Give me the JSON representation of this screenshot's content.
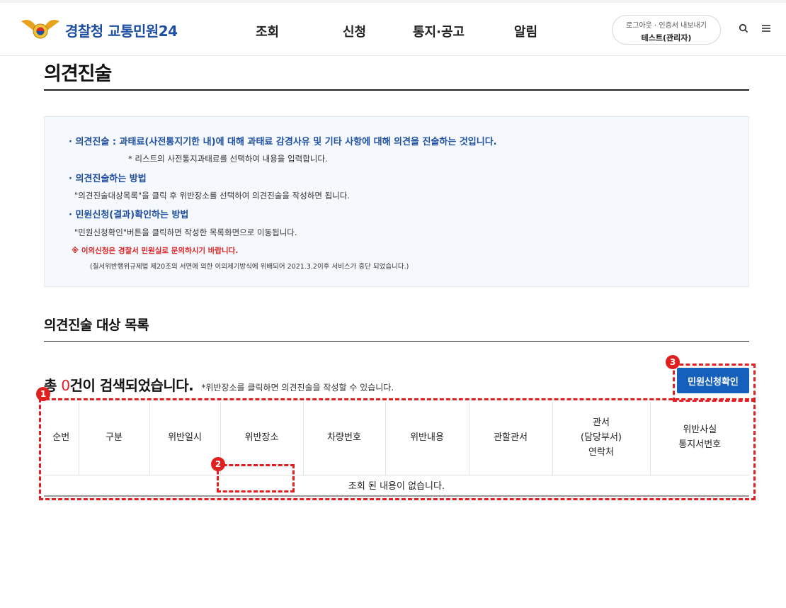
{
  "header": {
    "logo_text": "경찰청 교통민원24",
    "nav": [
      "조회",
      "신청",
      "통지·공고",
      "알림"
    ],
    "login_links": "로그아웃 · 인증서 내보내기",
    "user_name": "테스트(관리자)"
  },
  "page_title": "의견진술",
  "info": {
    "line1": "· 의견진술 : 과태료(사전통지기한 내)에 대해 과태료 감경사유 및 기타 사항에 대해 의견을 진술하는 것입니다.",
    "line2": "* 리스트의 사전통지과태료를 선택하여 내용을 입력합니다.",
    "line3": "· 의견진술하는 방법",
    "line4": "\"의견진술대상목록\"을 클릭 후 위반장소를 선택하여 의견진술을 작성하면 됩니다.",
    "line5": "· 민원신청(결과)확인하는 방법",
    "line6": "\"민원신청확인\"버튼을 클릭하면 작성한 목록화면으로 이동됩니다.",
    "line7": "※ 이의신청은 경찰서 민원실로 문의하시기 바랍니다.",
    "line8": "(질서위반행위규제법 제20조의 서면에 의한 이의제기방식에 위배되어 2021.3.2이후 서비스가 중단 되었습니다.)"
  },
  "section_title": "의견진술 대상 목록",
  "result": {
    "prefix": "총 ",
    "count": "0",
    "suffix": "건이 검색되었습니다.",
    "note": "*위반장소를 클릭하면 의견진술을 작성할 수 있습니다."
  },
  "confirm_button": "민원신청확인",
  "table": {
    "headers": [
      "순번",
      "구분",
      "위반일시",
      "위반장소",
      "차량번호",
      "위반내용",
      "관할관서",
      "관서\n(담당부서)\n연락처",
      "위반사실\n통지서번호"
    ],
    "empty_message": "조회 된 내용이 없습니다."
  },
  "annotations": [
    "1",
    "2",
    "3"
  ],
  "colors": {
    "brand_blue": "#1f4fa0",
    "button_blue": "#1560bd",
    "annotation_red": "#e02020"
  }
}
